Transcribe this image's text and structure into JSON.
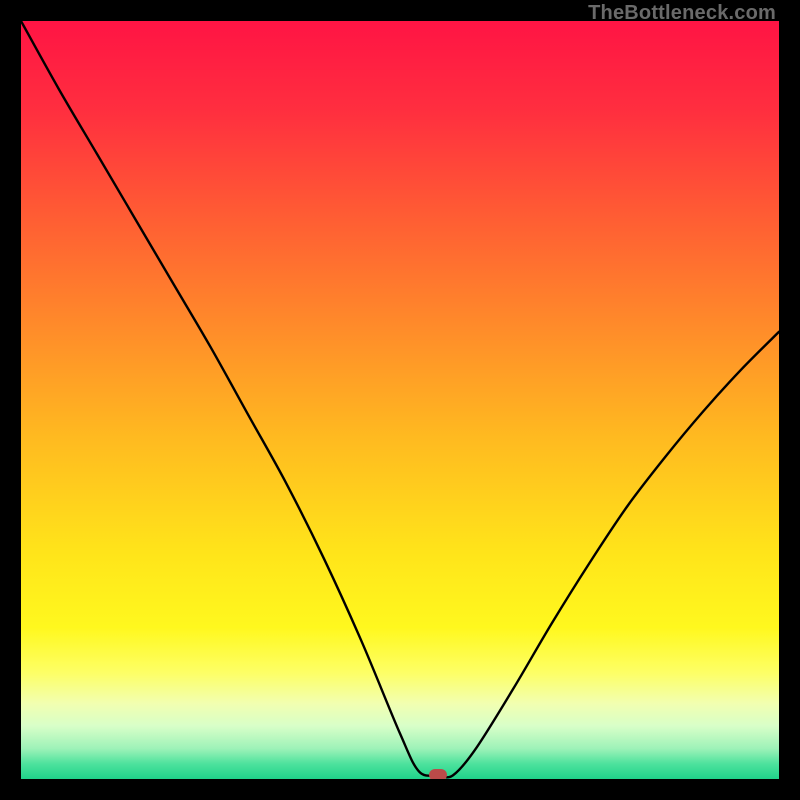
{
  "watermark": {
    "text": "TheBottleneck.com"
  },
  "chart_data": {
    "type": "line",
    "title": "",
    "xlabel": "",
    "ylabel": "",
    "xlim": [
      0,
      100
    ],
    "ylim": [
      0,
      100
    ],
    "grid": false,
    "legend": false,
    "background_gradient": {
      "direction": "vertical",
      "stops": [
        {
          "pos": 0.0,
          "color": "#ff1444"
        },
        {
          "pos": 0.12,
          "color": "#ff2f3f"
        },
        {
          "pos": 0.25,
          "color": "#ff5a34"
        },
        {
          "pos": 0.4,
          "color": "#ff8a2a"
        },
        {
          "pos": 0.55,
          "color": "#ffba20"
        },
        {
          "pos": 0.7,
          "color": "#ffe41a"
        },
        {
          "pos": 0.8,
          "color": "#fff81e"
        },
        {
          "pos": 0.86,
          "color": "#fdff66"
        },
        {
          "pos": 0.9,
          "color": "#f2ffb0"
        },
        {
          "pos": 0.93,
          "color": "#d8ffc8"
        },
        {
          "pos": 0.96,
          "color": "#9df2b8"
        },
        {
          "pos": 0.98,
          "color": "#4de29d"
        },
        {
          "pos": 1.0,
          "color": "#1fd28a"
        }
      ]
    },
    "series": [
      {
        "name": "bottleneck-curve",
        "color": "#000000",
        "x": [
          0,
          5,
          10,
          15,
          20,
          25,
          30,
          35,
          40,
          45,
          50,
          52.5,
          55,
          57,
          60,
          65,
          70,
          75,
          80,
          85,
          90,
          95,
          100
        ],
        "y": [
          100,
          91,
          82.5,
          74,
          65.5,
          57,
          48,
          39,
          29,
          18,
          6,
          1,
          0.5,
          0.5,
          4,
          12,
          20.5,
          28.5,
          36,
          42.5,
          48.5,
          54,
          59
        ]
      }
    ],
    "annotations": [
      {
        "name": "minimum-marker",
        "x": 55,
        "y": 0.5,
        "color": "#bb4a49"
      }
    ]
  }
}
